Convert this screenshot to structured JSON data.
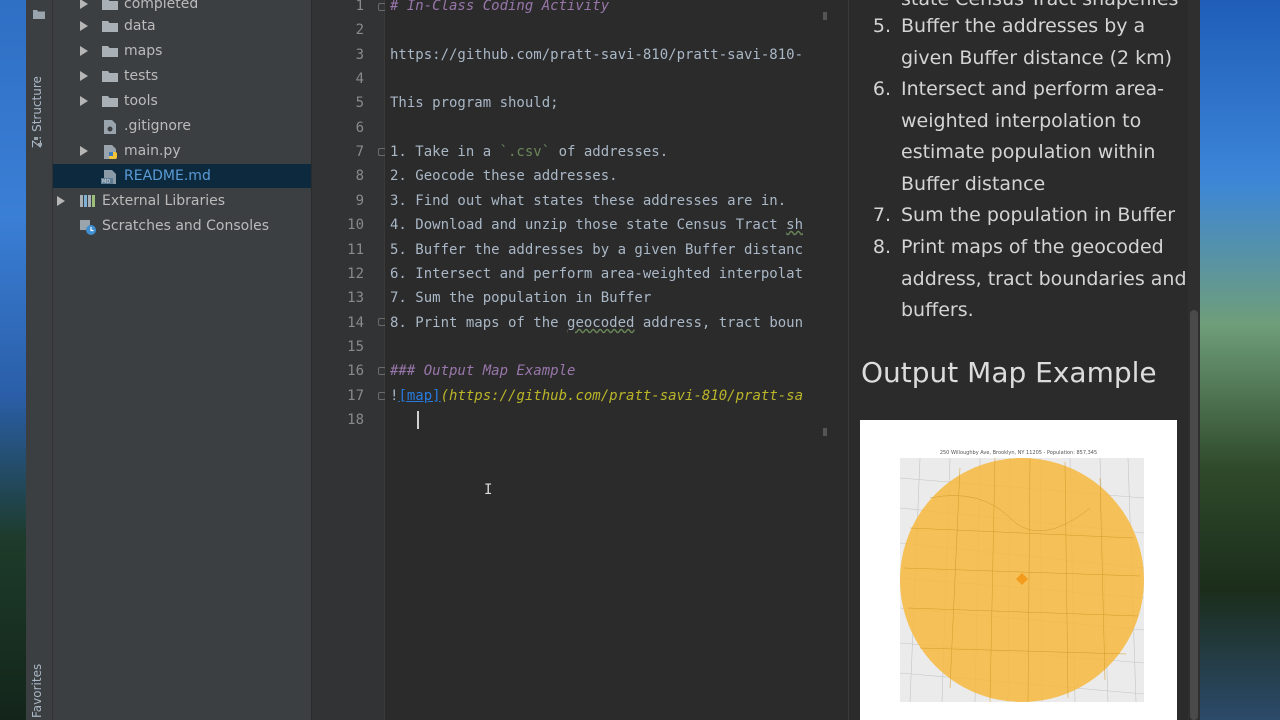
{
  "tool_strip": {
    "structure_label": "Z: Structure",
    "favorites_label": "Favorites"
  },
  "project_tree": {
    "items": [
      {
        "label": "completed",
        "type": "folder",
        "expandable": true
      },
      {
        "label": "data",
        "type": "folder",
        "expandable": true
      },
      {
        "label": "maps",
        "type": "folder",
        "expandable": true
      },
      {
        "label": "tests",
        "type": "folder",
        "expandable": true
      },
      {
        "label": "tools",
        "type": "folder",
        "expandable": true
      },
      {
        "label": ".gitignore",
        "type": "file",
        "expandable": false
      },
      {
        "label": "main.py",
        "type": "python-file",
        "expandable": true
      },
      {
        "label": "README.md",
        "type": "markdown-file",
        "expandable": false,
        "selected": true
      },
      {
        "label": "External Libraries",
        "type": "library",
        "expandable": true
      },
      {
        "label": "Scratches and Consoles",
        "type": "scratch",
        "expandable": false
      }
    ]
  },
  "editor": {
    "line_numbers": [
      "1",
      "2",
      "3",
      "4",
      "5",
      "6",
      "7",
      "8",
      "9",
      "10",
      "11",
      "12",
      "13",
      "14",
      "15",
      "16",
      "17",
      "18"
    ],
    "lines": {
      "l1": "# In-Class Coding Activity",
      "l3": "https://github.com/pratt-savi-810/pratt-savi-810-",
      "l5": "This program should;",
      "l7a": "1. Take in a ",
      "l7b": "`.csv`",
      "l7c": " of addresses.",
      "l8": "2. Geocode these addresses.",
      "l9": "3. Find out what states these addresses are in.",
      "l10a": "4. Download and unzip those state Census Tract ",
      "l10b": "sh",
      "l11": "5. Buffer the addresses by a given Buffer distanc",
      "l12": "6. Intersect and perform area-weighted interpolat",
      "l13": "7. Sum the population in Buffer",
      "l14a": "8. Print maps of the ",
      "l14b": "geocoded",
      "l14c": " address, tract boun",
      "l16": "### Output Map Example",
      "l17a": "!",
      "l17b": "[map]",
      "l17c": "(https://github.com/pratt-savi-810/pratt-sa"
    }
  },
  "preview": {
    "top_partial": "state Census Tract shapefiles",
    "list": [
      {
        "num": "5.",
        "text": "Buffer the addresses by a given Buffer distance (2 km)"
      },
      {
        "num": "6.",
        "text": "Intersect and perform area-weighted interpolation to estimate population within Buffer distance"
      },
      {
        "num": "7.",
        "text": "Sum the population in Buffer"
      },
      {
        "num": "8.",
        "text": "Print maps of the geocoded address, tract boundaries and buffers."
      }
    ],
    "heading": "Output Map Example",
    "map_caption": "250 Willoughby Ave, Brooklyn, NY 11205 - Population: 857,345"
  },
  "colors": {
    "accent": "#287bde",
    "buffer_fill": "#f5b942",
    "point": "#f29b1d",
    "selection": "#0d293e"
  }
}
